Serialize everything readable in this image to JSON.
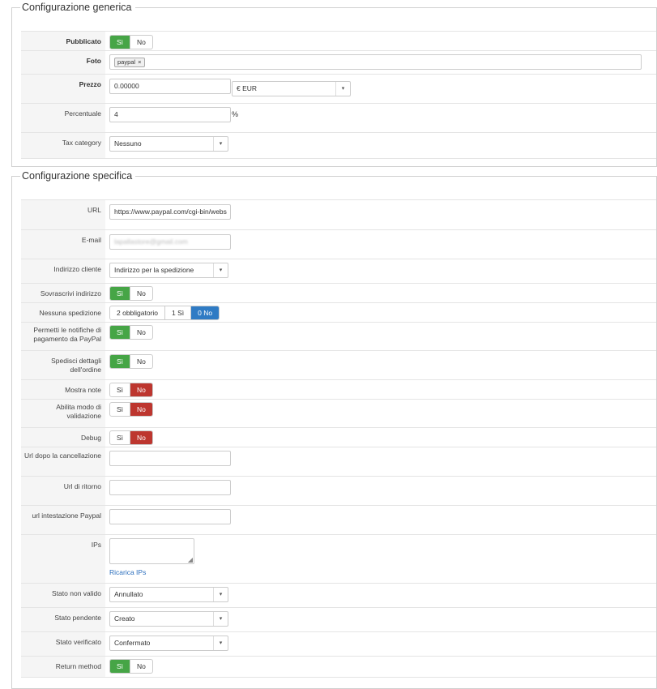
{
  "generic": {
    "legend": "Configurazione generica",
    "published": {
      "label": "Pubblicato",
      "yes": "Sì",
      "no": "No",
      "selected": "yes"
    },
    "photo": {
      "label": "Foto",
      "tag": "paypal",
      "tag_remove": "×"
    },
    "price": {
      "label": "Prezzo",
      "value": "0.00000",
      "currency": "€ EUR"
    },
    "percent": {
      "label": "Percentuale",
      "value": "4",
      "unit": "%"
    },
    "tax": {
      "label": "Tax category",
      "value": "Nessuno"
    }
  },
  "specific": {
    "legend": "Configurazione specifica",
    "url": {
      "label": "URL",
      "value": "https://www.paypal.com/cgi-bin/webs"
    },
    "email": {
      "label": "E-mail",
      "value": "lapallastore@gmail.com"
    },
    "address": {
      "label": "Indirizzo cliente",
      "value": "Indirizzo per la spedizione"
    },
    "override_address": {
      "label": "Sovrascrivi indirizzo",
      "yes": "Sì",
      "no": "No"
    },
    "no_shipping": {
      "label": "Nessuna spedizione",
      "opt1": "2 obbligatorio",
      "opt2": "1 Sì",
      "opt3": "0 No"
    },
    "notify": {
      "label": "Permetti le notifiche di pagamento da PayPal",
      "yes": "Sì",
      "no": "No"
    },
    "send_details": {
      "label": "Spedisci dettagli dell'ordine",
      "yes": "Sì",
      "no": "No"
    },
    "show_notes": {
      "label": "Mostra note",
      "yes": "Sì",
      "no": "No"
    },
    "validation": {
      "label": "Abilita modo di validazione",
      "yes": "Sì",
      "no": "No"
    },
    "debug": {
      "label": "Debug",
      "yes": "Sì",
      "no": "No"
    },
    "cancel_url": {
      "label": "Url dopo la cancellazione",
      "value": ""
    },
    "return_url": {
      "label": "Url di ritorno",
      "value": ""
    },
    "header_url": {
      "label": "url intestazione Paypal",
      "value": ""
    },
    "ips": {
      "label": "IPs",
      "reload": "Ricarica IPs"
    },
    "invalid_status": {
      "label": "Stato non valido",
      "value": "Annullato"
    },
    "pending_status": {
      "label": "Stato pendente",
      "value": "Creato"
    },
    "verified_status": {
      "label": "Stato verificato",
      "value": "Confermato"
    },
    "return_method": {
      "label": "Return method",
      "yes": "Sì",
      "no": "No"
    }
  },
  "colors": {
    "yes_active": "#46a546",
    "no_active": "#bd362f",
    "option_active": "#2f7bc4"
  }
}
